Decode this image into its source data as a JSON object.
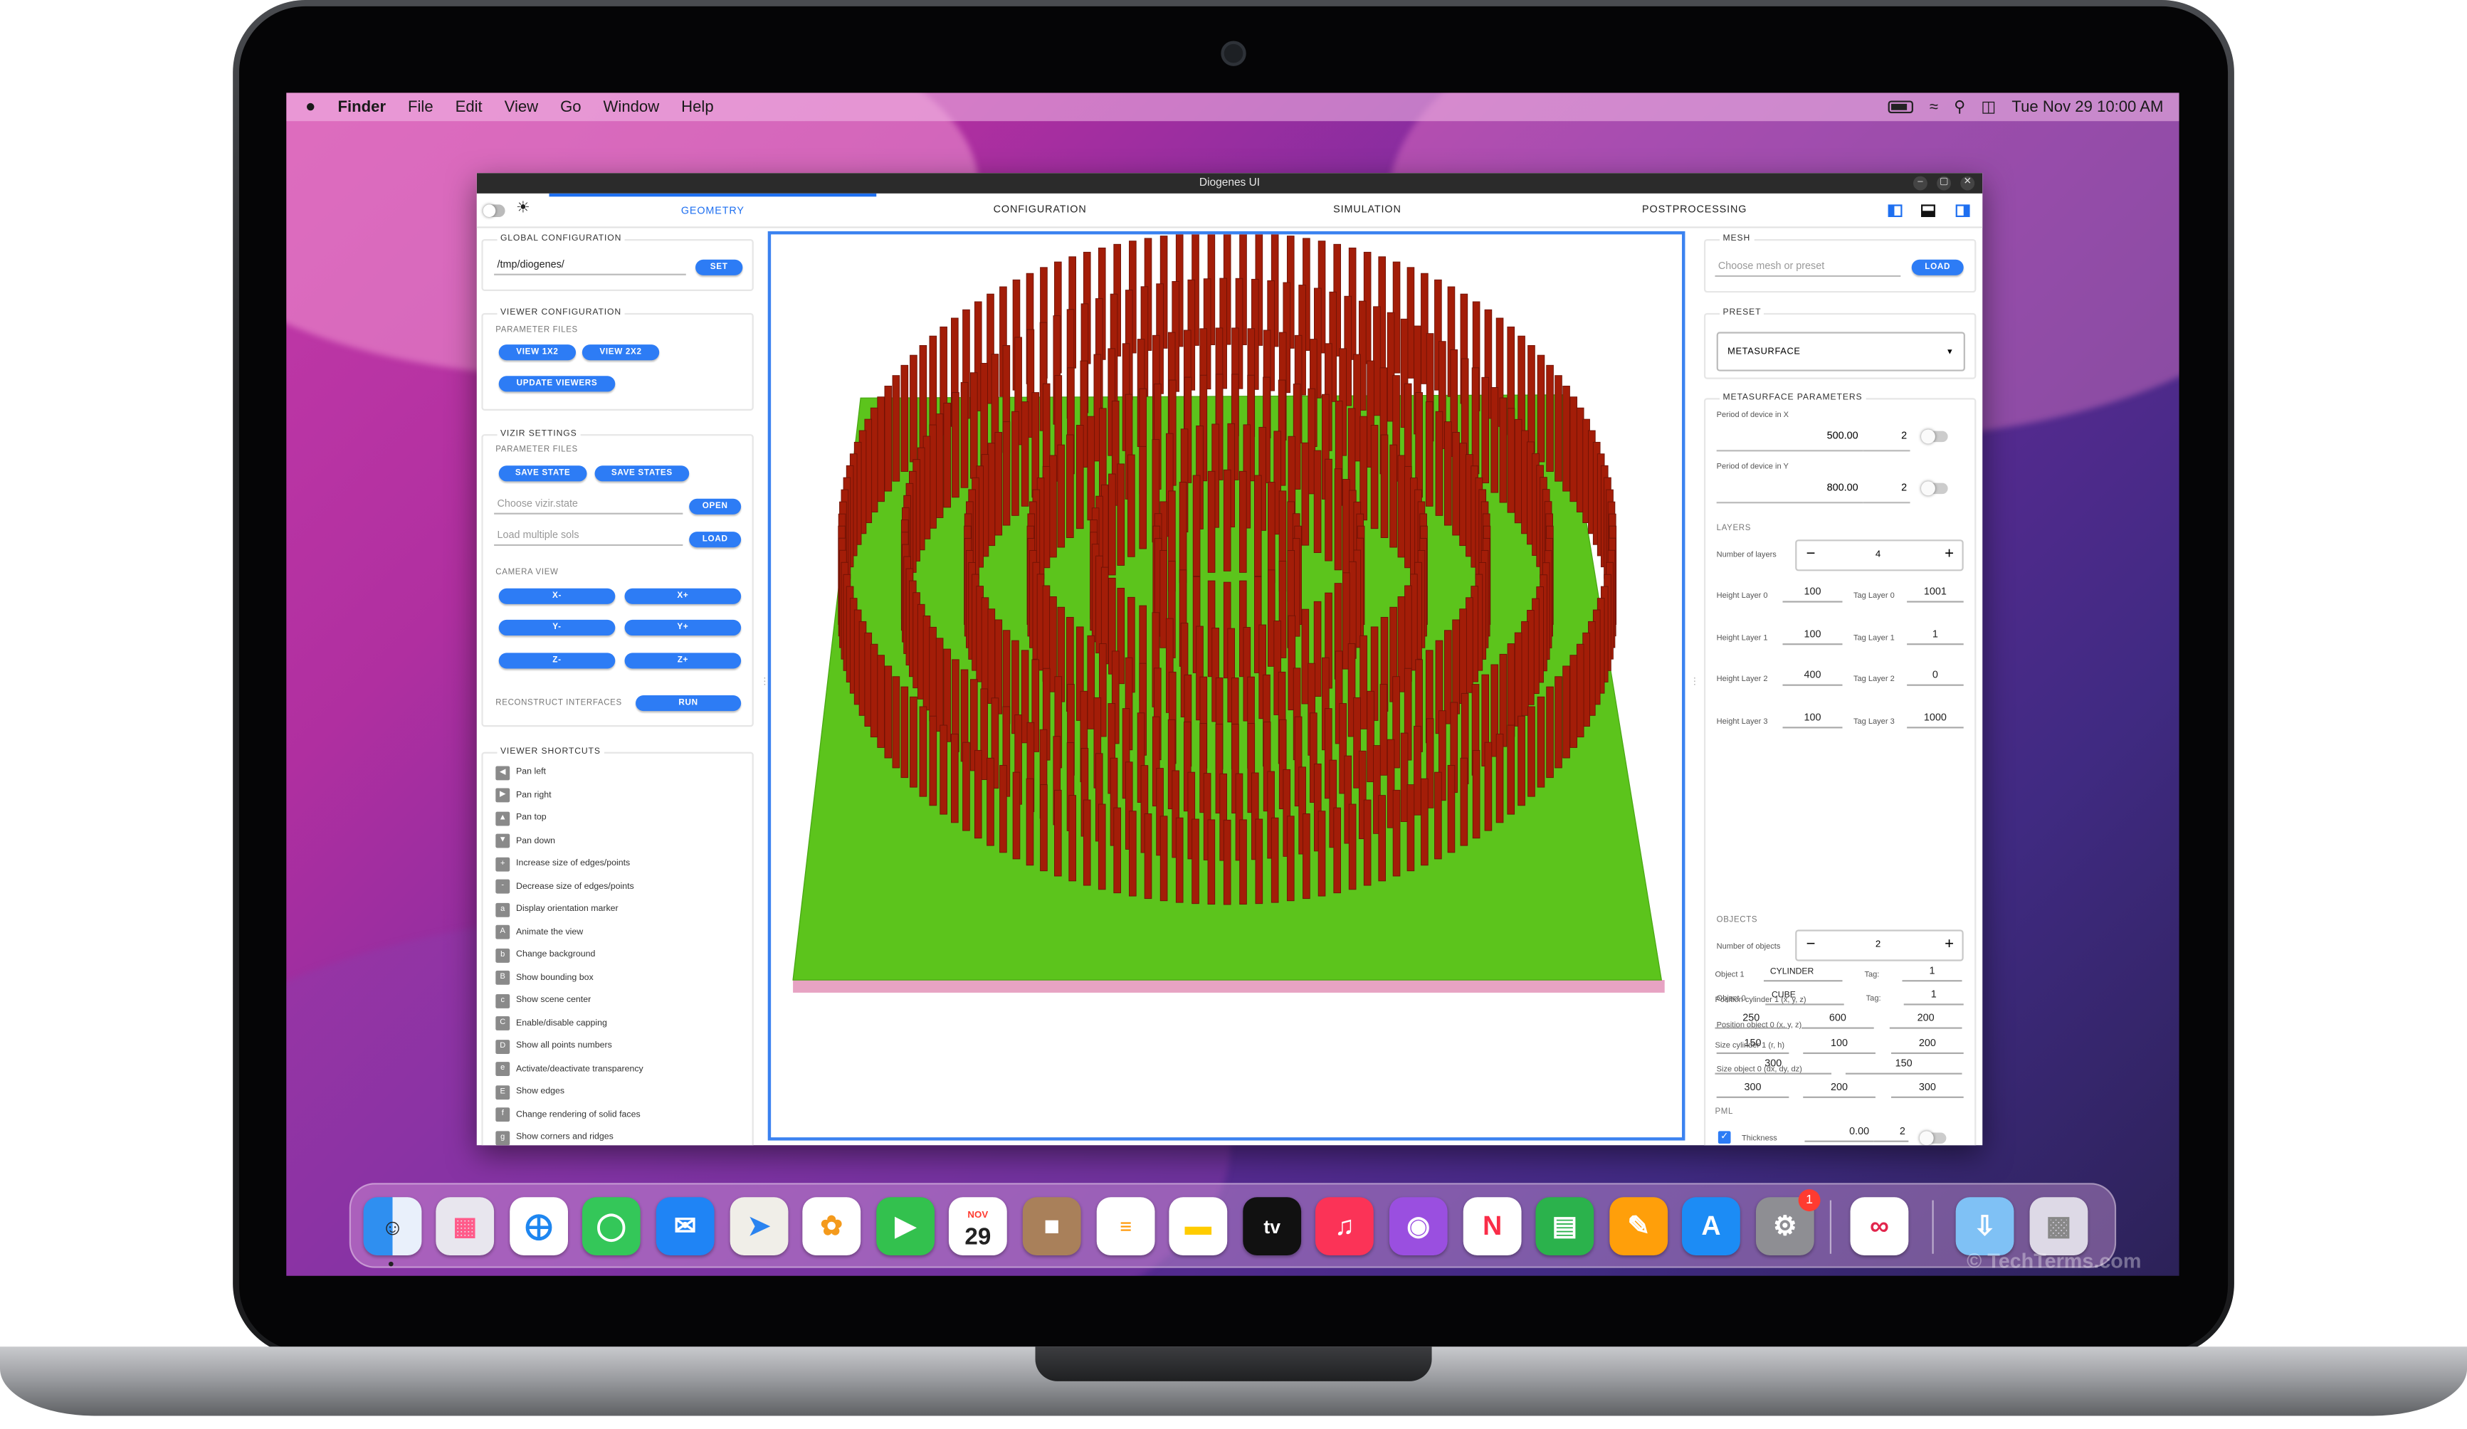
{
  "menubar": {
    "apple": "",
    "app": "Finder",
    "items": [
      "File",
      "Edit",
      "View",
      "Go",
      "Window",
      "Help"
    ],
    "datetime": "Tue Nov 29  10:00 AM"
  },
  "window": {
    "title": "Diogenes UI",
    "tabs": [
      "GEOMETRY",
      "CONFIGURATION",
      "SIMULATION",
      "POSTPROCESSING"
    ],
    "active_tab": "GEOMETRY"
  },
  "left": {
    "global": {
      "title": "GLOBAL CONFIGURATION",
      "path": "/tmp/diogenes/",
      "set": "SET"
    },
    "viewer": {
      "title": "VIEWER CONFIGURATION",
      "sub": "PARAMETER FILES",
      "view1": "VIEW 1X2",
      "view2": "VIEW 2X2",
      "update": "UPDATE VIEWERS"
    },
    "vizir": {
      "title": "VIZIR SETTINGS",
      "sub": "PARAMETER FILES",
      "save_state": "SAVE STATE",
      "save_states": "SAVE STATES",
      "choose_ph": "Choose vizir.state",
      "open": "OPEN",
      "load_ph": "Load multiple sols",
      "load": "LOAD",
      "camera": "CAMERA VIEW",
      "xm": "X-",
      "xp": "X+",
      "ym": "Y-",
      "yp": "Y+",
      "zm": "Z-",
      "zp": "Z+",
      "reconstruct": "RECONSTRUCT INTERFACES",
      "run": "RUN"
    },
    "shortcuts": {
      "title": "VIEWER SHORTCUTS",
      "items": [
        {
          "key": "◀",
          "label": "Pan left"
        },
        {
          "key": "▶",
          "label": "Pan right"
        },
        {
          "key": "▲",
          "label": "Pan top"
        },
        {
          "key": "▼",
          "label": "Pan down"
        },
        {
          "key": "+",
          "label": "Increase size of edges/points"
        },
        {
          "key": "-",
          "label": "Decrease size of edges/points"
        },
        {
          "key": "a",
          "label": "Display orientation marker"
        },
        {
          "key": "A",
          "label": "Animate the view"
        },
        {
          "key": "b",
          "label": "Change background"
        },
        {
          "key": "B",
          "label": "Show bounding box"
        },
        {
          "key": "c",
          "label": "Show scene center"
        },
        {
          "key": "C",
          "label": "Enable/disable capping"
        },
        {
          "key": "D",
          "label": "Show all points numbers"
        },
        {
          "key": "e",
          "label": "Activate/deactivate transparency"
        },
        {
          "key": "E",
          "label": "Show edges"
        },
        {
          "key": "f",
          "label": "Change rendering of solid faces"
        },
        {
          "key": "g",
          "label": "Show corners and ridges"
        }
      ]
    }
  },
  "right": {
    "mesh": {
      "title": "MESH",
      "placeholder": "Choose mesh or preset",
      "load": "LOAD"
    },
    "preset": {
      "title": "PRESET",
      "value": "METASURFACE"
    },
    "params": {
      "title": "METASURFACE PARAMETERS",
      "period_x_label": "Period of device in X",
      "period_x": "500.00",
      "period_x_n": "2",
      "period_y_label": "Period of device in Y",
      "period_y": "800.00",
      "period_y_n": "2",
      "layers_title": "LAYERS",
      "num_layers_label": "Number of layers",
      "num_layers": "4",
      "layers": [
        {
          "h_label": "Height Layer 0",
          "h": "100",
          "t_label": "Tag Layer 0",
          "t": "1001"
        },
        {
          "h_label": "Height Layer 1",
          "h": "100",
          "t_label": "Tag Layer 1",
          "t": "1"
        },
        {
          "h_label": "Height Layer 2",
          "h": "400",
          "t_label": "Tag Layer 2",
          "t": "0"
        },
        {
          "h_label": "Height Layer 3",
          "h": "100",
          "t_label": "Tag Layer 3",
          "t": "1000"
        }
      ],
      "objects_title": "OBJECTS",
      "num_objects_label": "Number of objects",
      "num_objects": "2",
      "obj0": {
        "label": "Object 0",
        "type": "CUBE",
        "tag_label": "Tag:",
        "tag": "1",
        "pos_label": "Position object 0 (x, y, z)",
        "pos": [
          "150",
          "100",
          "200"
        ],
        "size_label": "Size object 0 (dx, dy, dz)",
        "size": [
          "300",
          "200",
          "300"
        ]
      },
      "obj1": {
        "label": "Object 1",
        "type": "CYLINDER",
        "tag_label": "Tag:",
        "tag": "1",
        "pos_label": "Position cylinder 1 (x, y, z)",
        "pos": [
          "250",
          "600",
          "200"
        ],
        "size_label": "Size cylinder 1 (r, h)",
        "size": [
          "300",
          "150"
        ]
      },
      "pml_title": "PML",
      "thickness_label": "Thickness",
      "thickness": "0.00",
      "thickness_n": "2"
    }
  },
  "dock": {
    "calendar_month": "NOV",
    "calendar_day": "29",
    "badge": "1",
    "tv_label": "tv",
    "watermark": "© TechTerms.com"
  },
  "colors": {
    "accent": "#2d7cf5",
    "ground": "#5cc41c",
    "pillar": "#a31d08"
  }
}
